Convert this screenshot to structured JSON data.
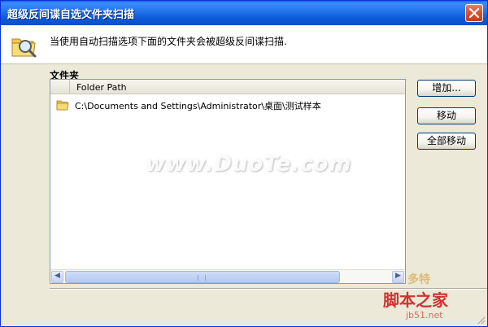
{
  "window": {
    "title": "超级反间谍自选文件夹扫描",
    "close_icon": "close-icon"
  },
  "header": {
    "icon": "folder-search-icon",
    "text": "当使用自动扫描选项下面的文件夹会被超级反间谍扫描."
  },
  "folders": {
    "label": "文件夹",
    "column_header": "Folder Path",
    "rows": [
      {
        "icon": "folder-icon",
        "path": "C:\\Documents and Settings\\Administrator\\桌面\\测试样本"
      }
    ]
  },
  "buttons": {
    "add": "增加...",
    "remove": "移动",
    "remove_all": "全部移动"
  },
  "watermarks": {
    "center": "www.DuoTe.com",
    "corner_top": "多特",
    "corner_mid": "脚本之家",
    "corner_bottom": "jb51.net"
  },
  "colors": {
    "titlebar": "#0a5bd8",
    "face": "#ece9d8",
    "accent_border": "#003c74"
  }
}
